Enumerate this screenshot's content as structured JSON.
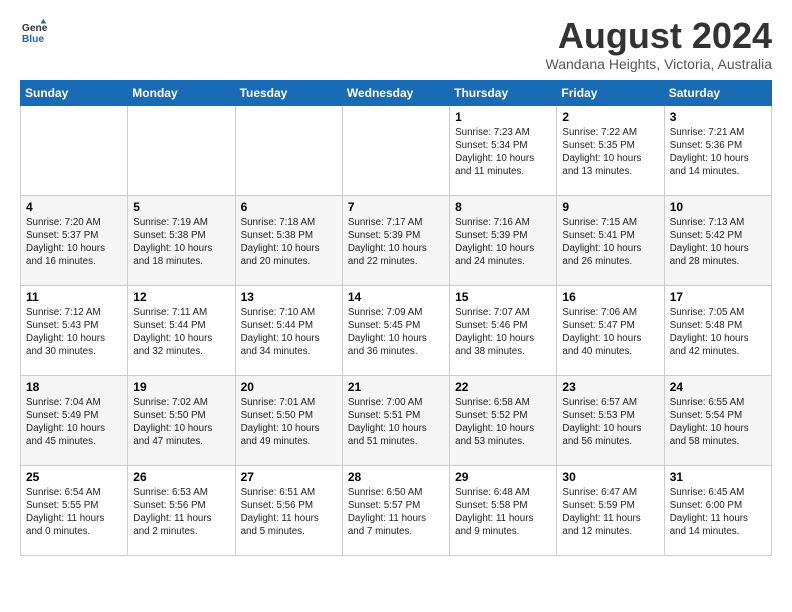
{
  "logo": {
    "line1": "General",
    "line2": "Blue"
  },
  "title": "August 2024",
  "location": "Wandana Heights, Victoria, Australia",
  "days_of_week": [
    "Sunday",
    "Monday",
    "Tuesday",
    "Wednesday",
    "Thursday",
    "Friday",
    "Saturday"
  ],
  "weeks": [
    [
      {
        "day": "",
        "info": ""
      },
      {
        "day": "",
        "info": ""
      },
      {
        "day": "",
        "info": ""
      },
      {
        "day": "",
        "info": ""
      },
      {
        "day": "1",
        "info": "Sunrise: 7:23 AM\nSunset: 5:34 PM\nDaylight: 10 hours\nand 11 minutes."
      },
      {
        "day": "2",
        "info": "Sunrise: 7:22 AM\nSunset: 5:35 PM\nDaylight: 10 hours\nand 13 minutes."
      },
      {
        "day": "3",
        "info": "Sunrise: 7:21 AM\nSunset: 5:36 PM\nDaylight: 10 hours\nand 14 minutes."
      }
    ],
    [
      {
        "day": "4",
        "info": "Sunrise: 7:20 AM\nSunset: 5:37 PM\nDaylight: 10 hours\nand 16 minutes."
      },
      {
        "day": "5",
        "info": "Sunrise: 7:19 AM\nSunset: 5:38 PM\nDaylight: 10 hours\nand 18 minutes."
      },
      {
        "day": "6",
        "info": "Sunrise: 7:18 AM\nSunset: 5:38 PM\nDaylight: 10 hours\nand 20 minutes."
      },
      {
        "day": "7",
        "info": "Sunrise: 7:17 AM\nSunset: 5:39 PM\nDaylight: 10 hours\nand 22 minutes."
      },
      {
        "day": "8",
        "info": "Sunrise: 7:16 AM\nSunset: 5:39 PM\nDaylight: 10 hours\nand 24 minutes."
      },
      {
        "day": "9",
        "info": "Sunrise: 7:15 AM\nSunset: 5:41 PM\nDaylight: 10 hours\nand 26 minutes."
      },
      {
        "day": "10",
        "info": "Sunrise: 7:13 AM\nSunset: 5:42 PM\nDaylight: 10 hours\nand 28 minutes."
      }
    ],
    [
      {
        "day": "11",
        "info": "Sunrise: 7:12 AM\nSunset: 5:43 PM\nDaylight: 10 hours\nand 30 minutes."
      },
      {
        "day": "12",
        "info": "Sunrise: 7:11 AM\nSunset: 5:44 PM\nDaylight: 10 hours\nand 32 minutes."
      },
      {
        "day": "13",
        "info": "Sunrise: 7:10 AM\nSunset: 5:44 PM\nDaylight: 10 hours\nand 34 minutes."
      },
      {
        "day": "14",
        "info": "Sunrise: 7:09 AM\nSunset: 5:45 PM\nDaylight: 10 hours\nand 36 minutes."
      },
      {
        "day": "15",
        "info": "Sunrise: 7:07 AM\nSunset: 5:46 PM\nDaylight: 10 hours\nand 38 minutes."
      },
      {
        "day": "16",
        "info": "Sunrise: 7:06 AM\nSunset: 5:47 PM\nDaylight: 10 hours\nand 40 minutes."
      },
      {
        "day": "17",
        "info": "Sunrise: 7:05 AM\nSunset: 5:48 PM\nDaylight: 10 hours\nand 42 minutes."
      }
    ],
    [
      {
        "day": "18",
        "info": "Sunrise: 7:04 AM\nSunset: 5:49 PM\nDaylight: 10 hours\nand 45 minutes."
      },
      {
        "day": "19",
        "info": "Sunrise: 7:02 AM\nSunset: 5:50 PM\nDaylight: 10 hours\nand 47 minutes."
      },
      {
        "day": "20",
        "info": "Sunrise: 7:01 AM\nSunset: 5:50 PM\nDaylight: 10 hours\nand 49 minutes."
      },
      {
        "day": "21",
        "info": "Sunrise: 7:00 AM\nSunset: 5:51 PM\nDaylight: 10 hours\nand 51 minutes."
      },
      {
        "day": "22",
        "info": "Sunrise: 6:58 AM\nSunset: 5:52 PM\nDaylight: 10 hours\nand 53 minutes."
      },
      {
        "day": "23",
        "info": "Sunrise: 6:57 AM\nSunset: 5:53 PM\nDaylight: 10 hours\nand 56 minutes."
      },
      {
        "day": "24",
        "info": "Sunrise: 6:55 AM\nSunset: 5:54 PM\nDaylight: 10 hours\nand 58 minutes."
      }
    ],
    [
      {
        "day": "25",
        "info": "Sunrise: 6:54 AM\nSunset: 5:55 PM\nDaylight: 11 hours\nand 0 minutes."
      },
      {
        "day": "26",
        "info": "Sunrise: 6:53 AM\nSunset: 5:56 PM\nDaylight: 11 hours\nand 2 minutes."
      },
      {
        "day": "27",
        "info": "Sunrise: 6:51 AM\nSunset: 5:56 PM\nDaylight: 11 hours\nand 5 minutes."
      },
      {
        "day": "28",
        "info": "Sunrise: 6:50 AM\nSunset: 5:57 PM\nDaylight: 11 hours\nand 7 minutes."
      },
      {
        "day": "29",
        "info": "Sunrise: 6:48 AM\nSunset: 5:58 PM\nDaylight: 11 hours\nand 9 minutes."
      },
      {
        "day": "30",
        "info": "Sunrise: 6:47 AM\nSunset: 5:59 PM\nDaylight: 11 hours\nand 12 minutes."
      },
      {
        "day": "31",
        "info": "Sunrise: 6:45 AM\nSunset: 6:00 PM\nDaylight: 11 hours\nand 14 minutes."
      }
    ]
  ]
}
